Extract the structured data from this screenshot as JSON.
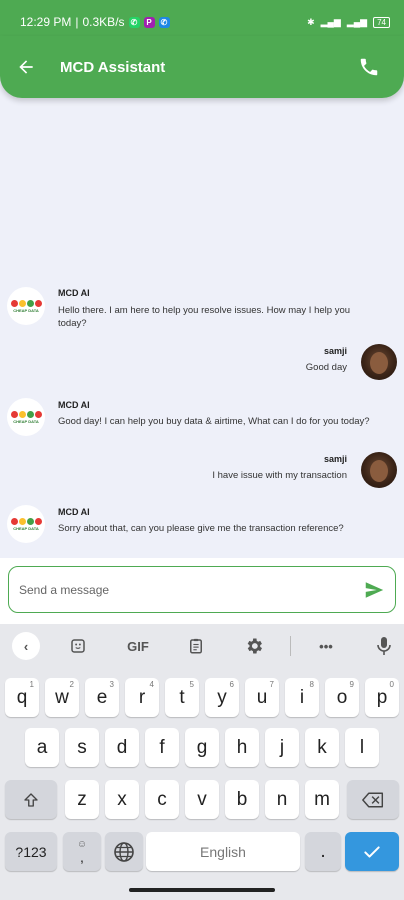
{
  "status_bar": {
    "time": "12:29 PM",
    "speed": "0.3KB/s",
    "battery": "74"
  },
  "header": {
    "title": "MCD Assistant",
    "back_icon": "arrow-left-icon",
    "call_icon": "phone-icon"
  },
  "messages": [
    {
      "sender": "bot",
      "name": "MCD AI",
      "text": "Hello there. I am here to help you resolve issues. How may I help you today?"
    },
    {
      "sender": "user",
      "name": "samji",
      "text": "Good day"
    },
    {
      "sender": "bot",
      "name": "MCD AI",
      "text": "Good day! I can help you buy data & airtime, What can I do for you today?"
    },
    {
      "sender": "user",
      "name": "samji",
      "text": "I have issue with my transaction"
    },
    {
      "sender": "bot",
      "name": "MCD AI",
      "text": "Sorry about that, can you please give me the transaction reference?"
    }
  ],
  "bot_logo_text": "CHEAP DATA",
  "composer": {
    "placeholder": "Send a message",
    "send_icon": "send-icon"
  },
  "keyboard": {
    "toolbar": {
      "gif_label": "GIF"
    },
    "row1": [
      {
        "k": "q",
        "h": "1"
      },
      {
        "k": "w",
        "h": "2"
      },
      {
        "k": "e",
        "h": "3"
      },
      {
        "k": "r",
        "h": "4"
      },
      {
        "k": "t",
        "h": "5"
      },
      {
        "k": "y",
        "h": "6"
      },
      {
        "k": "u",
        "h": "7"
      },
      {
        "k": "i",
        "h": "8"
      },
      {
        "k": "o",
        "h": "9"
      },
      {
        "k": "p",
        "h": "0"
      }
    ],
    "row2": [
      "a",
      "s",
      "d",
      "f",
      "g",
      "h",
      "j",
      "k",
      "l"
    ],
    "row3": [
      "z",
      "x",
      "c",
      "v",
      "b",
      "n",
      "m"
    ],
    "symbols_label": "?123",
    "comma_label": ",",
    "space_label": "English",
    "period_label": ".",
    "emoji_hint": "☺"
  },
  "colors": {
    "primary": "#4eaa52",
    "background": "#eef0f9",
    "enter_key": "#3497de"
  }
}
